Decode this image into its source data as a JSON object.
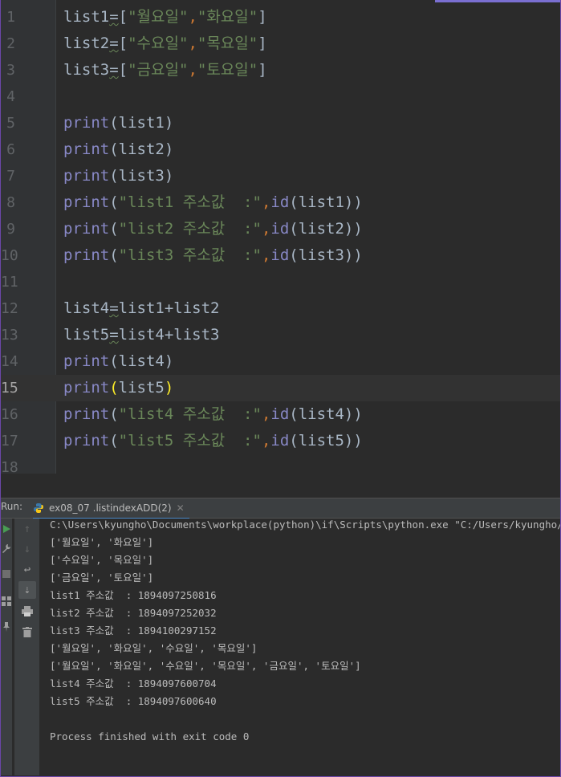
{
  "editor": {
    "lines": [
      {
        "no": "1",
        "tokens": [
          {
            "t": "list1",
            "c": ""
          },
          {
            "t": "=",
            "c": "wav"
          },
          {
            "t": "[",
            "c": ""
          },
          {
            "t": "\"월요일\"",
            "c": "str"
          },
          {
            "t": ",",
            "c": "sq"
          },
          {
            "t": "\"화요일\"",
            "c": "str"
          },
          {
            "t": "]",
            "c": ""
          }
        ]
      },
      {
        "no": "2",
        "tokens": [
          {
            "t": "list2",
            "c": ""
          },
          {
            "t": "=",
            "c": "wav"
          },
          {
            "t": "[",
            "c": ""
          },
          {
            "t": "\"수요일\"",
            "c": "str"
          },
          {
            "t": ",",
            "c": "sq"
          },
          {
            "t": "\"목요일\"",
            "c": "str"
          },
          {
            "t": "]",
            "c": ""
          }
        ]
      },
      {
        "no": "3",
        "tokens": [
          {
            "t": "list3",
            "c": ""
          },
          {
            "t": "=",
            "c": "wav"
          },
          {
            "t": "[",
            "c": ""
          },
          {
            "t": "\"금요일\"",
            "c": "str"
          },
          {
            "t": ",",
            "c": "sq"
          },
          {
            "t": "\"토요일\"",
            "c": "str"
          },
          {
            "t": "]",
            "c": ""
          }
        ]
      },
      {
        "no": "4",
        "tokens": []
      },
      {
        "no": "5",
        "tokens": [
          {
            "t": "print",
            "c": "kw"
          },
          {
            "t": "(list1)",
            "c": ""
          }
        ]
      },
      {
        "no": "6",
        "tokens": [
          {
            "t": "print",
            "c": "kw"
          },
          {
            "t": "(list2)",
            "c": ""
          }
        ]
      },
      {
        "no": "7",
        "tokens": [
          {
            "t": "print",
            "c": "kw"
          },
          {
            "t": "(list3)",
            "c": ""
          }
        ]
      },
      {
        "no": "8",
        "tokens": [
          {
            "t": "print",
            "c": "kw"
          },
          {
            "t": "(",
            "c": ""
          },
          {
            "t": "\"list1 주소값  :\"",
            "c": "str"
          },
          {
            "t": ",",
            "c": "sq"
          },
          {
            "t": "id",
            "c": "kw"
          },
          {
            "t": "(list1))",
            "c": ""
          }
        ]
      },
      {
        "no": "9",
        "tokens": [
          {
            "t": "print",
            "c": "kw"
          },
          {
            "t": "(",
            "c": ""
          },
          {
            "t": "\"list2 주소값  :\"",
            "c": "str"
          },
          {
            "t": ",",
            "c": "sq"
          },
          {
            "t": "id",
            "c": "kw"
          },
          {
            "t": "(list2))",
            "c": ""
          }
        ]
      },
      {
        "no": "10",
        "tokens": [
          {
            "t": "print",
            "c": "kw"
          },
          {
            "t": "(",
            "c": ""
          },
          {
            "t": "\"list3 주소값  :\"",
            "c": "str"
          },
          {
            "t": ",",
            "c": "sq"
          },
          {
            "t": "id",
            "c": "kw"
          },
          {
            "t": "(list3))",
            "c": ""
          }
        ]
      },
      {
        "no": "11",
        "tokens": []
      },
      {
        "no": "12",
        "tokens": [
          {
            "t": "list4",
            "c": ""
          },
          {
            "t": "=",
            "c": "wav"
          },
          {
            "t": "list1+list2",
            "c": ""
          }
        ]
      },
      {
        "no": "13",
        "tokens": [
          {
            "t": "list5",
            "c": ""
          },
          {
            "t": "=",
            "c": "wav"
          },
          {
            "t": "list4+list3",
            "c": ""
          }
        ]
      },
      {
        "no": "14",
        "tokens": [
          {
            "t": "print",
            "c": "kw"
          },
          {
            "t": "(list4)",
            "c": ""
          }
        ]
      },
      {
        "no": "15",
        "current": true,
        "tokens": [
          {
            "t": "print",
            "c": "kw"
          },
          {
            "t": "(",
            "c": "hl"
          },
          {
            "t": "list5",
            "c": ""
          },
          {
            "t": ")",
            "c": "hl"
          }
        ]
      },
      {
        "no": "16",
        "tokens": [
          {
            "t": "print",
            "c": "kw"
          },
          {
            "t": "(",
            "c": ""
          },
          {
            "t": "\"list4 주소값  :\"",
            "c": "str"
          },
          {
            "t": ",",
            "c": "sq"
          },
          {
            "t": "id",
            "c": "kw"
          },
          {
            "t": "(list4))",
            "c": ""
          }
        ]
      },
      {
        "no": "17",
        "tokens": [
          {
            "t": "print",
            "c": "kw"
          },
          {
            "t": "(",
            "c": ""
          },
          {
            "t": "\"list5 주소값  :\"",
            "c": "str"
          },
          {
            "t": ",",
            "c": "sq"
          },
          {
            "t": "id",
            "c": "kw"
          },
          {
            "t": "(list5))",
            "c": ""
          }
        ]
      },
      {
        "no": "18",
        "tokens": []
      }
    ]
  },
  "run_panel": {
    "label": "Run:",
    "tab_title": "ex08_07 .listindexADD(2)",
    "close_glyph": "✕"
  },
  "console": {
    "lines": [
      "C:\\Users\\kyungho\\Documents\\workplace(python)\\if\\Scripts\\python.exe \"C:/Users/kyungho/",
      "['월요일', '화요일']",
      "['수요일', '목요일']",
      "['금요일', '토요일']",
      "list1 주소값  : 1894097250816",
      "list2 주소값  : 1894097252032",
      "list3 주소값  : 1894100297152",
      "['월요일', '화요일', '수요일', '목요일']",
      "['월요일', '화요일', '수요일', '목요일', '금요일', '토요일']",
      "list4 주소값  : 1894097600704",
      "list5 주소값  : 1894097600640",
      "",
      "Process finished with exit code 0"
    ]
  },
  "colors": {
    "background": "#2b2b2b",
    "keyword": "#8888c6",
    "string": "#6a8759",
    "identifier": "#a9b7c6",
    "brace_highlight": "#ffef28",
    "run_green": "#499c54"
  }
}
